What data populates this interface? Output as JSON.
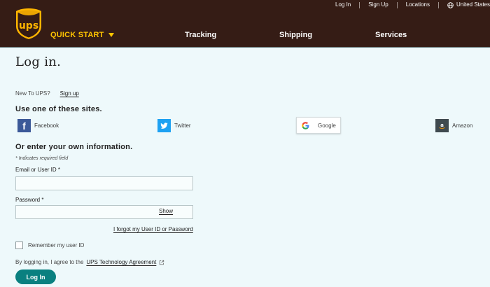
{
  "header": {
    "logo_text": "ups",
    "utility_links": [
      "Log In",
      "Sign Up",
      "Locations"
    ],
    "locale": "United States",
    "quick_start": "QUICK START",
    "nav": [
      "Tracking",
      "Shipping",
      "Services"
    ]
  },
  "page": {
    "title": "Log in.",
    "new_to": "New To UPS?",
    "signup": "Sign up",
    "social_heading": "Use one of these sites.",
    "social": {
      "facebook": "Facebook",
      "twitter": "Twitter",
      "google": "Google",
      "amazon": "Amazon"
    },
    "form_heading": "Or enter your own information.",
    "required_note": "* Indicates required field",
    "email_label": "Email or User ID *",
    "email_value": "",
    "password_label": "Password *",
    "password_value": "",
    "show": "Show",
    "forgot": "I forgot my User ID or Password",
    "remember": "Remember my user ID",
    "agree_prefix": "By logging in, I agree to the",
    "agree_link": "UPS Technology Agreement",
    "login_button": "Log In"
  },
  "colors": {
    "header_bg": "#351c15",
    "accent_yellow": "#ffc400",
    "button_teal": "#0a8080",
    "page_bg": "#eef9fb"
  }
}
